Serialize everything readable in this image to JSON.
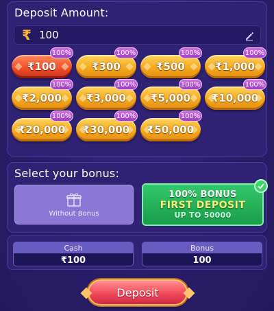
{
  "deposit": {
    "title": "Deposit Amount:",
    "currency_symbol": "₹",
    "amount_value": "100",
    "chips": [
      {
        "label": "₹100",
        "badge": "100%",
        "selected": true
      },
      {
        "label": "₹300",
        "badge": "100%"
      },
      {
        "label": "₹500",
        "badge": "100%"
      },
      {
        "label": "₹1,000",
        "badge": "100%"
      },
      {
        "label": "₹2,000",
        "badge": "100%"
      },
      {
        "label": "₹3,000",
        "badge": "100%"
      },
      {
        "label": "₹5,000",
        "badge": "100%"
      },
      {
        "label": "₹10,000",
        "badge": "100%"
      },
      {
        "label": "₹20,000",
        "badge": "100%"
      },
      {
        "label": "₹30,000",
        "badge": "100%"
      },
      {
        "label": "₹50,000",
        "badge": "100%"
      }
    ]
  },
  "bonus": {
    "title": "Select your bonus:",
    "without_label": "Without Bonus",
    "first_deposit": {
      "line1": "100% BONUS",
      "line2": "FIRST DEPOSIT",
      "line3": "UP TO 50000"
    }
  },
  "summary": {
    "cash_label": "Cash",
    "cash_value": "₹100",
    "bonus_label": "Bonus",
    "bonus_value": "100"
  },
  "deposit_button": "Deposit",
  "colors": {
    "background": "#2c1f6e",
    "chip_gold": "#f6a91e",
    "chip_selected": "#f0502a",
    "bonus_green": "#1b9c4a",
    "deposit_red": "#f14a5a"
  }
}
